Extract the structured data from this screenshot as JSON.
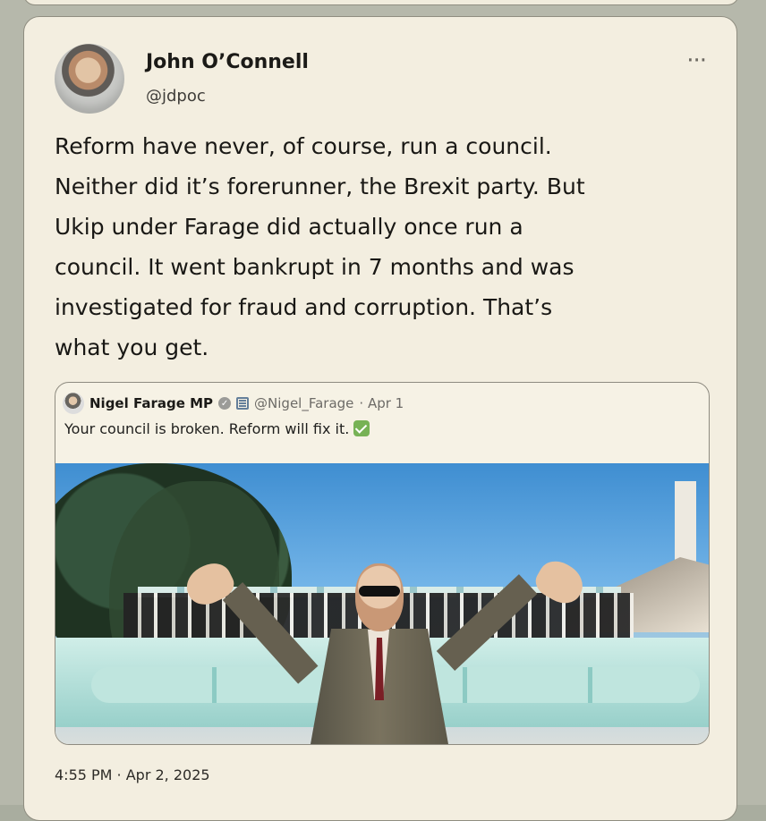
{
  "tweet": {
    "author_name": "John O’Connell",
    "author_handle": "@jdpoc",
    "more_label": "···",
    "text": "Reform have never, of course, run a council.\nNeither did it’s forerunner, the Brexit party. But\nUkip under Farage did actually once run a\ncouncil. It went bankrupt in 7 months and was\ninvestigated for fraud and corruption. That’s\nwhat you get.",
    "timestamp": "4:55 PM · Apr 2, 2025"
  },
  "quoted_tweet": {
    "author_name": "Nigel Farage MP",
    "author_handle": "@Nigel_Farage",
    "date": "· Apr 1",
    "text": "Your council is broken. Reform will fix it.",
    "verified_icon": "verified-badge-icon",
    "government_icon": "government-label-icon",
    "checkmark_icon": "check-mark-icon"
  }
}
